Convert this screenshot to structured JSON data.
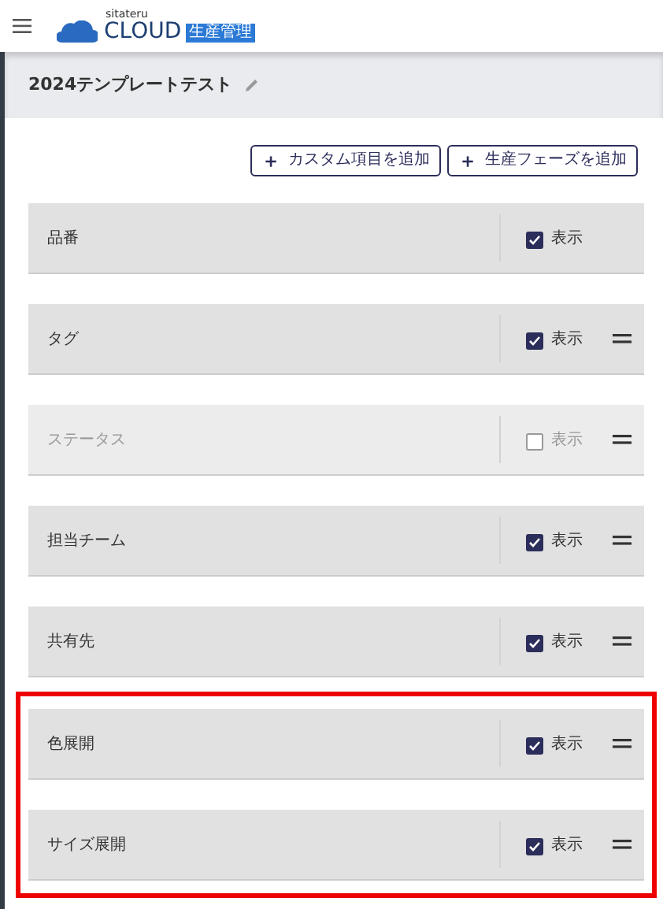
{
  "header": {
    "brand": "sitateru",
    "logo_text": "CLOUD",
    "logo_badge": "生産管理"
  },
  "title": "2024テンプレートテスト",
  "buttons": [
    {
      "label": "カスタム項目を追加",
      "icon": "＋"
    },
    {
      "label": "生産フェーズを追加",
      "icon": "＋"
    }
  ],
  "rows": [
    {
      "label": "品番",
      "checked": true,
      "disabled": false,
      "draggable": false,
      "toggle_label": "表示"
    },
    {
      "label": "タグ",
      "checked": true,
      "disabled": false,
      "draggable": true,
      "toggle_label": "表示"
    },
    {
      "label": "ステータス",
      "checked": false,
      "disabled": true,
      "draggable": true,
      "toggle_label": "表示"
    },
    {
      "label": "担当チーム",
      "checked": true,
      "disabled": false,
      "draggable": true,
      "toggle_label": "表示"
    },
    {
      "label": "共有先",
      "checked": true,
      "disabled": false,
      "draggable": true,
      "toggle_label": "表示"
    }
  ],
  "highlight_frame": {
    "rows": [
      {
        "label": "色展開",
        "checked": true,
        "disabled": false,
        "draggable": true,
        "toggle_label": "表示"
      },
      {
        "label": "サイズ展開",
        "checked": true,
        "disabled": false,
        "draggable": true,
        "toggle_label": "表示"
      }
    ]
  }
}
